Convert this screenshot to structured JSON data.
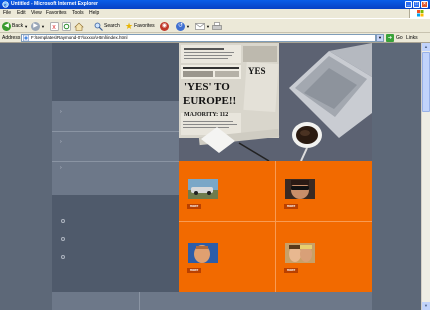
{
  "window": {
    "title": "Untitled - Microsoft Internet Explorer",
    "controls": {
      "minimize": "_",
      "maximize": "□",
      "close": "×"
    }
  },
  "menubar": {
    "items": [
      "File",
      "Edit",
      "View",
      "Favorites",
      "Tools",
      "Help"
    ]
  },
  "toolbar": {
    "back_label": "Back",
    "search_label": "Search",
    "favorites_label": "Favorites"
  },
  "addressbar": {
    "label": "Address",
    "value": "F:\\templates\\Raymond-0?\\xxxxx\\Html\\index.html",
    "go_label": "Go",
    "links_label": "Links"
  },
  "collage": {
    "headline_yes": "YES",
    "headline_main": "'YES' TO",
    "headline_europe": "EUROPE!!",
    "headline_majority": "MAJORITY: 112"
  },
  "gallery": {
    "items": [
      {
        "button_label": "more"
      },
      {
        "button_label": "more"
      },
      {
        "button_label": "more"
      },
      {
        "button_label": "more"
      }
    ]
  },
  "colors": {
    "accent": "#f26a00",
    "page_bg": "#5d6878",
    "panel_dark": "#4f5a6b",
    "titlebar": "#0a5ee8"
  }
}
